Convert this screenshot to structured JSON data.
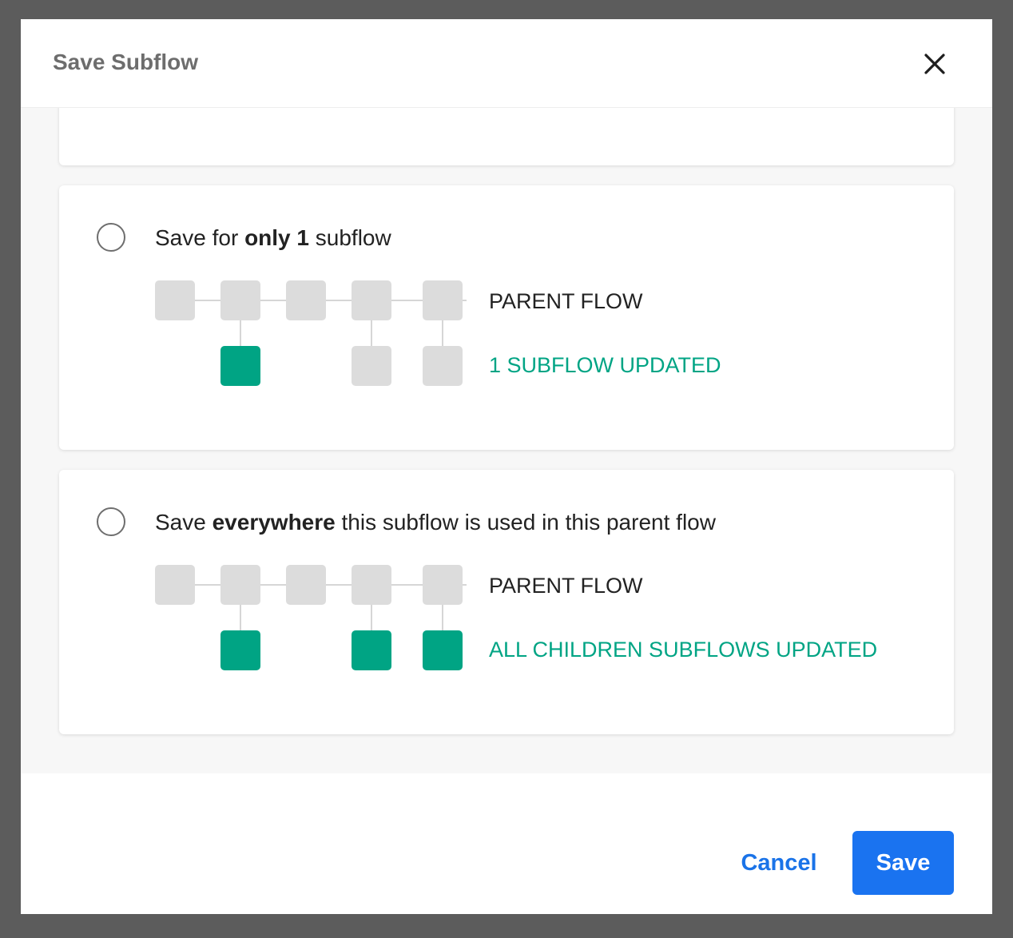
{
  "dialog": {
    "title": "Save Subflow",
    "close_icon": "close-icon"
  },
  "options": [
    {
      "label_pre": "Save for ",
      "label_bold": "only 1",
      "label_post": " subflow",
      "selected": false,
      "parent_label": "PARENT FLOW",
      "updated_label": "1 SUBFLOW UPDATED",
      "children_updated": [
        true,
        false,
        false
      ]
    },
    {
      "label_pre": "Save ",
      "label_bold": "everywhere",
      "label_post": " this subflow is used in this parent flow",
      "selected": false,
      "parent_label": "PARENT FLOW",
      "updated_label": "ALL CHILDREN SUBFLOWS UPDATED",
      "children_updated": [
        true,
        true,
        true
      ]
    }
  ],
  "footer": {
    "cancel_label": "Cancel",
    "save_label": "Save"
  },
  "colors": {
    "accent_green": "#00a484",
    "primary_blue": "#1a73f0",
    "node_gray": "#dcdcdc"
  }
}
